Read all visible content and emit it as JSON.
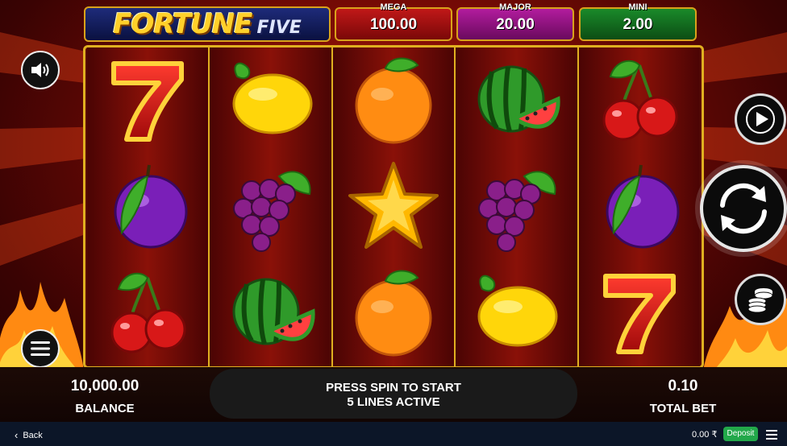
{
  "game": {
    "title_word1": "FORTUNE",
    "title_word2": "FIVE"
  },
  "jackpots": [
    {
      "label": "MEGA",
      "value": "100.00"
    },
    {
      "label": "MAJOR",
      "value": "20.00"
    },
    {
      "label": "MINI",
      "value": "2.00"
    }
  ],
  "reels": [
    [
      "seven",
      "plum",
      "cherry"
    ],
    [
      "lemon",
      "grapes",
      "watermelon"
    ],
    [
      "orange",
      "star",
      "orange"
    ],
    [
      "watermelon",
      "grapes",
      "lemon"
    ],
    [
      "cherry",
      "plum",
      "seven"
    ]
  ],
  "controls": {
    "sound_icon": "speaker-icon",
    "menu_icon": "hamburger-menu-icon",
    "autoplay_icon": "play-icon",
    "spin_icon": "spin-arrows-icon",
    "bet_icon": "coin-stack-icon"
  },
  "status": {
    "balance_value": "10,000.00",
    "balance_label": "BALANCE",
    "message_line1": "PRESS SPIN TO START",
    "message_line2": "5 LINES ACTIVE",
    "total_bet_value": "0.10",
    "total_bet_label": "TOTAL BET"
  },
  "system_bar": {
    "back_label": "Back",
    "wallet_balance": "0.00 ₹",
    "deposit_label": "Deposit"
  },
  "colors": {
    "mega": "#c01818",
    "major": "#b21c9e",
    "mini": "#1a8a2a",
    "frame_gold": "#e0b020"
  }
}
